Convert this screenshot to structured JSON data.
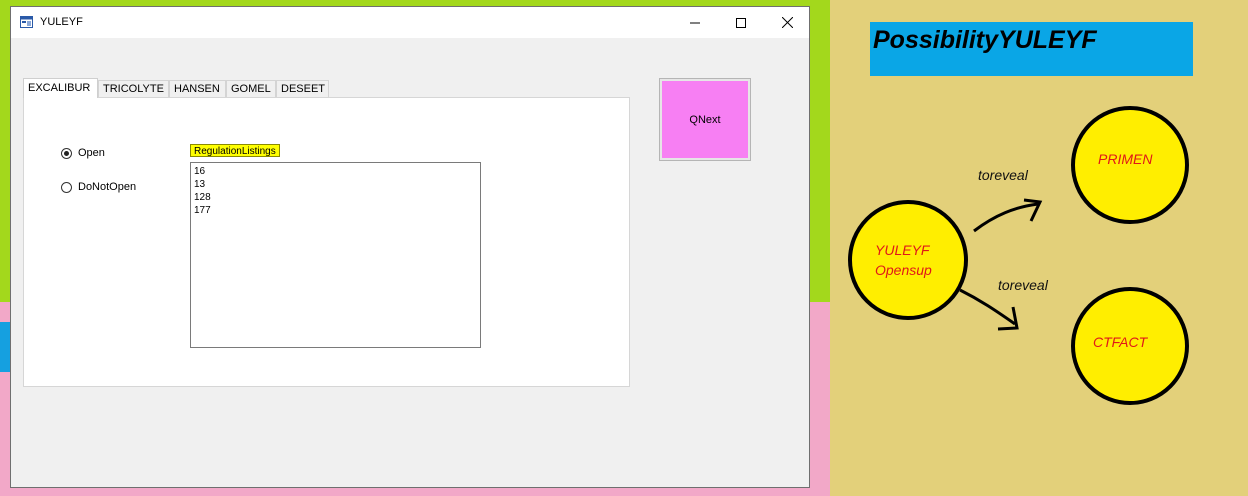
{
  "window": {
    "title": "YULEYF",
    "controls": [
      "minimize-icon",
      "maximize-icon",
      "close-icon"
    ]
  },
  "tabs": [
    {
      "label": "EXCALIBUR",
      "active": true
    },
    {
      "label": "TRICOLYTE",
      "active": false
    },
    {
      "label": "HANSEN",
      "active": false
    },
    {
      "label": "GOMEL",
      "active": false
    },
    {
      "label": "DESEET",
      "active": false
    }
  ],
  "radios": {
    "open": {
      "label": "Open",
      "checked": true
    },
    "donotopen": {
      "label": "DoNotOpen",
      "checked": false
    }
  },
  "listings": {
    "label": "RegulationListings",
    "items": [
      "16",
      "13",
      "128",
      "177"
    ]
  },
  "qnext": {
    "label": "QNext"
  },
  "diagram": {
    "title": "PossibilityYULEYF",
    "source_node": {
      "line1": "YULEYF",
      "line2": "Opensup"
    },
    "node_top": "PRIMEN",
    "node_bottom": "CTFACT",
    "edge_top": "toreveal",
    "edge_bottom": "toreveal"
  },
  "colors": {
    "qnext_bg": "#f77ff3",
    "label_highlight": "#ffff00",
    "title_bg": "#0aa6e6",
    "node_fill": "#ffee00",
    "node_text": "#e01818",
    "desktop_lime": "#a3d81c",
    "desktop_pink": "#f2a8c8",
    "panel_tan": "#e3d07a"
  }
}
